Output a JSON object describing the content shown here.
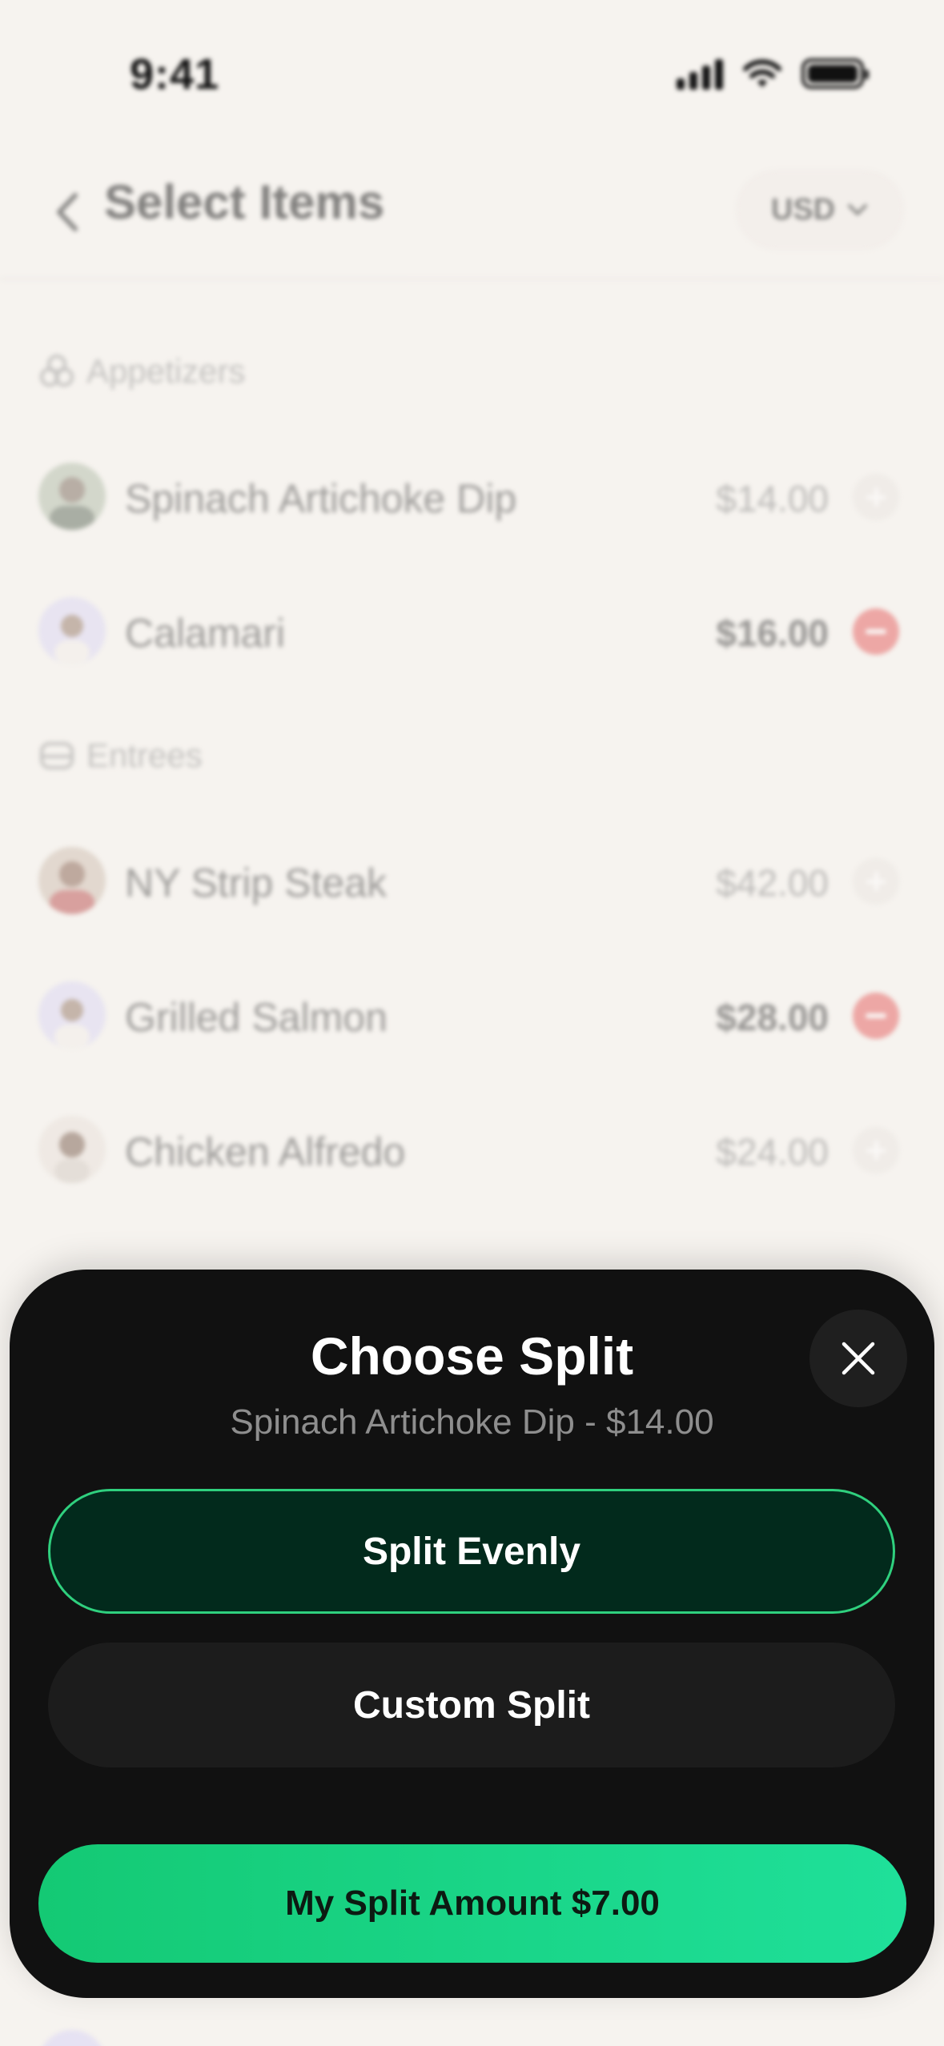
{
  "status_bar": {
    "time": "9:41"
  },
  "header": {
    "title": "Select Items",
    "currency": "USD"
  },
  "sections": [
    {
      "label": "Appetizers",
      "items": [
        {
          "name": "Spinach Artichoke Dip",
          "price": "$14.00",
          "state": "add"
        },
        {
          "name": "Calamari",
          "price": "$16.00",
          "state": "remove"
        }
      ]
    },
    {
      "label": "Entrees",
      "items": [
        {
          "name": "NY Strip Steak",
          "price": "$42.00",
          "state": "add"
        },
        {
          "name": "Grilled Salmon",
          "price": "$28.00",
          "state": "remove"
        },
        {
          "name": "Chicken Alfredo",
          "price": "$24.00",
          "state": "add"
        }
      ]
    }
  ],
  "sheet": {
    "title": "Choose Split",
    "subtitle": "Spinach Artichoke Dip - $14.00",
    "options": [
      {
        "label": "Split Evenly",
        "selected": true
      },
      {
        "label": "Custom Split",
        "selected": false
      }
    ],
    "cta_label": "My Split Amount $7.00"
  },
  "colors": {
    "accent": "#1fd887",
    "remove": "#e24b4b",
    "sheet_bg": "#111111",
    "page_bg": "#f6f3ef"
  }
}
